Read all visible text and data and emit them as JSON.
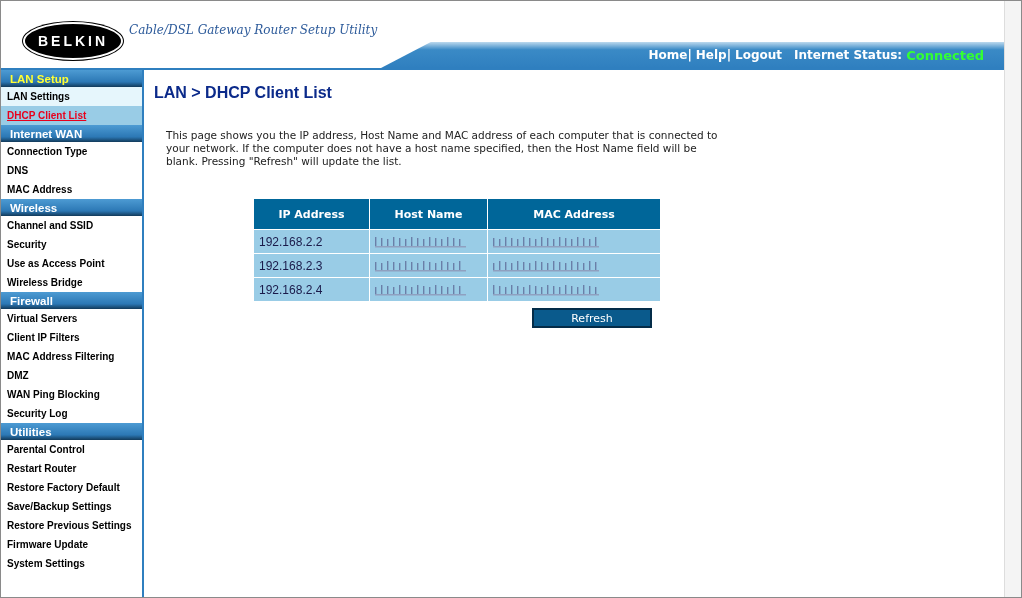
{
  "header": {
    "logo": "BELKIN",
    "tagline": "Cable/DSL Gateway Router Setup Utility",
    "links": [
      "Home|",
      "Help|",
      "Logout"
    ],
    "status_label": "Internet Status:",
    "status_value": "Connected",
    "connected": true
  },
  "sidebar": [
    {
      "title": "LAN Setup",
      "selected": true,
      "items": [
        {
          "label": "LAN Settings",
          "selected": false,
          "highlighted": true
        },
        {
          "label": "DHCP Client List",
          "selected": true,
          "highlighted": false
        }
      ]
    },
    {
      "title": "Internet WAN",
      "selected": false,
      "items": [
        {
          "label": "Connection Type",
          "selected": false,
          "highlighted": false
        },
        {
          "label": "DNS",
          "selected": false,
          "highlighted": false
        },
        {
          "label": "MAC Address",
          "selected": false,
          "highlighted": false
        }
      ]
    },
    {
      "title": "Wireless",
      "selected": false,
      "items": [
        {
          "label": "Channel and SSID",
          "selected": false,
          "highlighted": false
        },
        {
          "label": "Security",
          "selected": false,
          "highlighted": false
        },
        {
          "label": "Use as Access Point",
          "selected": false,
          "highlighted": false
        },
        {
          "label": "Wireless Bridge",
          "selected": false,
          "highlighted": false
        }
      ]
    },
    {
      "title": "Firewall",
      "selected": false,
      "items": [
        {
          "label": "Virtual Servers",
          "selected": false,
          "highlighted": false
        },
        {
          "label": "Client IP Filters",
          "selected": false,
          "highlighted": false
        },
        {
          "label": "MAC Address Filtering",
          "selected": false,
          "highlighted": false
        },
        {
          "label": "DMZ",
          "selected": false,
          "highlighted": false
        },
        {
          "label": "WAN Ping Blocking",
          "selected": false,
          "highlighted": false
        },
        {
          "label": "Security Log",
          "selected": false,
          "highlighted": false
        }
      ]
    },
    {
      "title": "Utilities",
      "selected": false,
      "items": [
        {
          "label": "Parental Control",
          "selected": false,
          "highlighted": false
        },
        {
          "label": "Restart Router",
          "selected": false,
          "highlighted": false
        },
        {
          "label": "Restore Factory Default",
          "selected": false,
          "highlighted": false
        },
        {
          "label": "Save/Backup Settings",
          "selected": false,
          "highlighted": false
        },
        {
          "label": "Restore Previous Settings",
          "selected": false,
          "highlighted": false
        },
        {
          "label": "Firmware Update",
          "selected": false,
          "highlighted": false
        },
        {
          "label": "System Settings",
          "selected": false,
          "highlighted": false
        }
      ]
    }
  ],
  "content": {
    "title": "LAN > DHCP Client List",
    "description": "This page shows you the IP address, Host Name and MAC address of each computer that is connected to your network. If the computer does not have a host name specified, then the Host Name field will be blank. Pressing \"Refresh\" will update the list.",
    "table": {
      "columns": [
        "IP Address",
        "Host Name",
        "MAC Address"
      ],
      "rows": [
        {
          "ip": "192.168.2.2",
          "host_redacted": true,
          "mac_redacted": true
        },
        {
          "ip": "192.168.2.3",
          "host_redacted": true,
          "mac_redacted": true
        },
        {
          "ip": "192.168.2.4",
          "host_redacted": true,
          "mac_redacted": true
        }
      ]
    },
    "button": "Refresh"
  }
}
